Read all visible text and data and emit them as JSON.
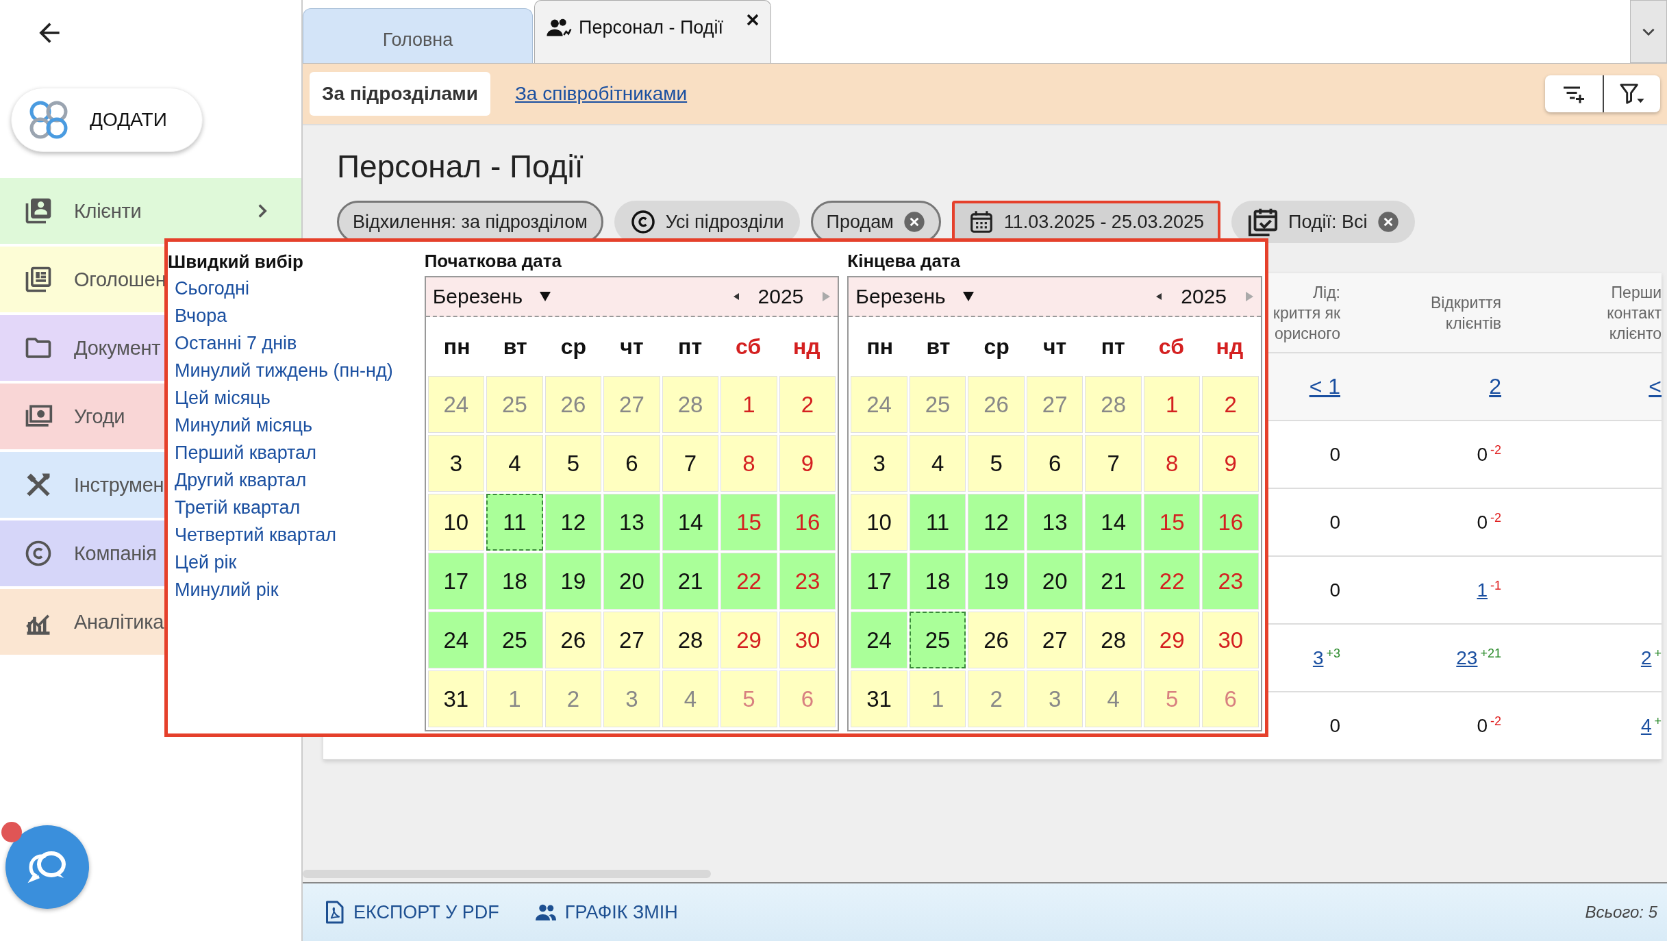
{
  "add_button": "ДОДАТИ",
  "sidebar": {
    "items": [
      {
        "label": "Клієнти",
        "kind": "contacts",
        "color": "#dff9d9",
        "has_submenu": true
      },
      {
        "label": "Оголошен",
        "kind": "news",
        "color": "#fdfdd6"
      },
      {
        "label": "Документ",
        "kind": "folder",
        "color": "#e3d7f9"
      },
      {
        "label": "Угоди",
        "kind": "money",
        "color": "#f9d6d6"
      },
      {
        "label": "Інструмен",
        "kind": "tools",
        "color": "#d8e8fb"
      },
      {
        "label": "Компанія",
        "kind": "company",
        "color": "#d6d6f9"
      },
      {
        "label": "Аналітика",
        "kind": "analytics",
        "color": "#fbe6d2"
      }
    ]
  },
  "tabs": [
    {
      "label": "Головна",
      "selected": false,
      "closable": false
    },
    {
      "label": "Персонал - Події",
      "selected": true,
      "closable": true
    }
  ],
  "subtabs": [
    {
      "label": "За підрозділами",
      "selected": true
    },
    {
      "label": "За співробітниками",
      "selected": false
    }
  ],
  "page_title": "Персонал - Події",
  "chips": [
    {
      "label": "Відхилення: за підрозділом",
      "kind": "deviation",
      "outlined": true,
      "closable": false,
      "active": false
    },
    {
      "label": "Усі підрозділи",
      "kind": "department",
      "outlined": false,
      "closable": false,
      "active": false
    },
    {
      "label": "Продам",
      "kind": "category",
      "outlined": true,
      "closable": true,
      "active": false
    },
    {
      "label": "11.03.2025 - 25.03.2025",
      "kind": "period",
      "outlined": true,
      "closable": false,
      "active": true
    },
    {
      "label": "Події: Всі",
      "kind": "events",
      "outlined": false,
      "closable": true,
      "active": false
    }
  ],
  "table": {
    "columns": [
      {
        "lines": [
          "Лід:",
          "криття як",
          "орисного"
        ]
      },
      {
        "lines": [
          "Відкриття",
          "клієнтів"
        ]
      },
      {
        "lines": [
          "Перши",
          "контакт",
          "клієнто"
        ]
      }
    ],
    "total": [
      {
        "value": "< 1",
        "link": true
      },
      {
        "value": "2",
        "link": true
      },
      {
        "value": "<",
        "link": true
      }
    ],
    "rows": [
      {
        "cells": [
          {
            "value": "0",
            "link": false
          },
          {
            "value": "0",
            "link": false,
            "delta": "-2",
            "color": "#e02020"
          }
        ]
      },
      {
        "cells": [
          {
            "value": "0",
            "link": false
          },
          {
            "value": "0",
            "link": false,
            "delta": "-2",
            "color": "#e02020"
          }
        ]
      },
      {
        "cells": [
          {
            "value": "0",
            "link": false
          },
          {
            "value": "1",
            "link": true,
            "delta": "-1",
            "color": "#e02020"
          }
        ]
      },
      {
        "cells": [
          {
            "value": "3",
            "link": true,
            "delta": "+3",
            "color": "#2a8a2a"
          },
          {
            "value": "23",
            "link": true,
            "delta": "+21",
            "color": "#2a8a2a"
          },
          {
            "value": "2",
            "link": true,
            "delta": "+",
            "color": "#2a8a2a"
          }
        ]
      },
      {
        "cells": [
          {
            "value": "0",
            "link": false
          },
          {
            "value": "0",
            "link": false,
            "delta": "-2",
            "color": "#e02020"
          },
          {
            "value": "4",
            "link": true,
            "delta": "+",
            "color": "#2a8a2a"
          }
        ]
      }
    ]
  },
  "popup": {
    "quick_title": "Швидкий вибір",
    "quick_items": [
      "Сьогодні",
      "Вчора",
      "Останні 7 днів",
      "Минулий тиждень (пн-нд)",
      "Цей місяць",
      "Минулий місяць",
      "Перший квартал",
      "Другий квартал",
      "Третій квартал",
      "Четвертий квартал",
      "Цей рік",
      "Минулий рік"
    ],
    "calendars": [
      {
        "label": "Початкова дата",
        "month": "Березень",
        "year": "2025",
        "weekdays": [
          "пн",
          "вт",
          "ср",
          "чт",
          "пт",
          "сб",
          "нд"
        ],
        "weeks": [
          [
            {
              "d": "24",
              "outside": true,
              "in_range": false,
              "selected": false
            },
            {
              "d": "25",
              "outside": true,
              "in_range": false,
              "selected": false
            },
            {
              "d": "26",
              "outside": true,
              "in_range": false,
              "selected": false
            },
            {
              "d": "27",
              "outside": true,
              "in_range": false,
              "selected": false
            },
            {
              "d": "28",
              "outside": true,
              "in_range": false,
              "selected": false
            },
            {
              "d": "1",
              "outside": false,
              "in_range": false,
              "selected": false
            },
            {
              "d": "2",
              "outside": false,
              "in_range": false,
              "selected": false
            }
          ],
          [
            {
              "d": "3",
              "outside": false,
              "in_range": false,
              "selected": false
            },
            {
              "d": "4",
              "outside": false,
              "in_range": false,
              "selected": false
            },
            {
              "d": "5",
              "outside": false,
              "in_range": false,
              "selected": false
            },
            {
              "d": "6",
              "outside": false,
              "in_range": false,
              "selected": false
            },
            {
              "d": "7",
              "outside": false,
              "in_range": false,
              "selected": false
            },
            {
              "d": "8",
              "outside": false,
              "in_range": false,
              "selected": false
            },
            {
              "d": "9",
              "outside": false,
              "in_range": false,
              "selected": false
            }
          ],
          [
            {
              "d": "10",
              "outside": false,
              "in_range": false,
              "selected": false
            },
            {
              "d": "11",
              "outside": false,
              "in_range": true,
              "selected": true
            },
            {
              "d": "12",
              "outside": false,
              "in_range": true,
              "selected": false
            },
            {
              "d": "13",
              "outside": false,
              "in_range": true,
              "selected": false
            },
            {
              "d": "14",
              "outside": false,
              "in_range": true,
              "selected": false
            },
            {
              "d": "15",
              "outside": false,
              "in_range": true,
              "selected": false
            },
            {
              "d": "16",
              "outside": false,
              "in_range": true,
              "selected": false
            }
          ],
          [
            {
              "d": "17",
              "outside": false,
              "in_range": true,
              "selected": false
            },
            {
              "d": "18",
              "outside": false,
              "in_range": true,
              "selected": false
            },
            {
              "d": "19",
              "outside": false,
              "in_range": true,
              "selected": false
            },
            {
              "d": "20",
              "outside": false,
              "in_range": true,
              "selected": false
            },
            {
              "d": "21",
              "outside": false,
              "in_range": true,
              "selected": false
            },
            {
              "d": "22",
              "outside": false,
              "in_range": true,
              "selected": false
            },
            {
              "d": "23",
              "outside": false,
              "in_range": true,
              "selected": false
            }
          ],
          [
            {
              "d": "24",
              "outside": false,
              "in_range": true,
              "selected": false
            },
            {
              "d": "25",
              "outside": false,
              "in_range": true,
              "selected": false
            },
            {
              "d": "26",
              "outside": false,
              "in_range": false,
              "selected": false
            },
            {
              "d": "27",
              "outside": false,
              "in_range": false,
              "selected": false
            },
            {
              "d": "28",
              "outside": false,
              "in_range": false,
              "selected": false
            },
            {
              "d": "29",
              "outside": false,
              "in_range": false,
              "selected": false
            },
            {
              "d": "30",
              "outside": false,
              "in_range": false,
              "selected": false
            }
          ],
          [
            {
              "d": "31",
              "outside": false,
              "in_range": false,
              "selected": false
            },
            {
              "d": "1",
              "outside": true,
              "in_range": false,
              "selected": false
            },
            {
              "d": "2",
              "outside": true,
              "in_range": false,
              "selected": false
            },
            {
              "d": "3",
              "outside": true,
              "in_range": false,
              "selected": false
            },
            {
              "d": "4",
              "outside": true,
              "in_range": false,
              "selected": false
            },
            {
              "d": "5",
              "outside": true,
              "in_range": false,
              "selected": false
            },
            {
              "d": "6",
              "outside": true,
              "in_range": false,
              "selected": false
            }
          ]
        ]
      },
      {
        "label": "Кінцева дата",
        "month": "Березень",
        "year": "2025",
        "weekdays": [
          "пн",
          "вт",
          "ср",
          "чт",
          "пт",
          "сб",
          "нд"
        ],
        "weeks": [
          [
            {
              "d": "24",
              "outside": true,
              "in_range": false,
              "selected": false
            },
            {
              "d": "25",
              "outside": true,
              "in_range": false,
              "selected": false
            },
            {
              "d": "26",
              "outside": true,
              "in_range": false,
              "selected": false
            },
            {
              "d": "27",
              "outside": true,
              "in_range": false,
              "selected": false
            },
            {
              "d": "28",
              "outside": true,
              "in_range": false,
              "selected": false
            },
            {
              "d": "1",
              "outside": false,
              "in_range": false,
              "selected": false
            },
            {
              "d": "2",
              "outside": false,
              "in_range": false,
              "selected": false
            }
          ],
          [
            {
              "d": "3",
              "outside": false,
              "in_range": false,
              "selected": false
            },
            {
              "d": "4",
              "outside": false,
              "in_range": false,
              "selected": false
            },
            {
              "d": "5",
              "outside": false,
              "in_range": false,
              "selected": false
            },
            {
              "d": "6",
              "outside": false,
              "in_range": false,
              "selected": false
            },
            {
              "d": "7",
              "outside": false,
              "in_range": false,
              "selected": false
            },
            {
              "d": "8",
              "outside": false,
              "in_range": false,
              "selected": false
            },
            {
              "d": "9",
              "outside": false,
              "in_range": false,
              "selected": false
            }
          ],
          [
            {
              "d": "10",
              "outside": false,
              "in_range": false,
              "selected": false
            },
            {
              "d": "11",
              "outside": false,
              "in_range": true,
              "selected": false
            },
            {
              "d": "12",
              "outside": false,
              "in_range": true,
              "selected": false
            },
            {
              "d": "13",
              "outside": false,
              "in_range": true,
              "selected": false
            },
            {
              "d": "14",
              "outside": false,
              "in_range": true,
              "selected": false
            },
            {
              "d": "15",
              "outside": false,
              "in_range": true,
              "selected": false
            },
            {
              "d": "16",
              "outside": false,
              "in_range": true,
              "selected": false
            }
          ],
          [
            {
              "d": "17",
              "outside": false,
              "in_range": true,
              "selected": false
            },
            {
              "d": "18",
              "outside": false,
              "in_range": true,
              "selected": false
            },
            {
              "d": "19",
              "outside": false,
              "in_range": true,
              "selected": false
            },
            {
              "d": "20",
              "outside": false,
              "in_range": true,
              "selected": false
            },
            {
              "d": "21",
              "outside": false,
              "in_range": true,
              "selected": false
            },
            {
              "d": "22",
              "outside": false,
              "in_range": true,
              "selected": false
            },
            {
              "d": "23",
              "outside": false,
              "in_range": true,
              "selected": false
            }
          ],
          [
            {
              "d": "24",
              "outside": false,
              "in_range": true,
              "selected": false
            },
            {
              "d": "25",
              "outside": false,
              "in_range": true,
              "selected": true
            },
            {
              "d": "26",
              "outside": false,
              "in_range": false,
              "selected": false
            },
            {
              "d": "27",
              "outside": false,
              "in_range": false,
              "selected": false
            },
            {
              "d": "28",
              "outside": false,
              "in_range": false,
              "selected": false
            },
            {
              "d": "29",
              "outside": false,
              "in_range": false,
              "selected": false
            },
            {
              "d": "30",
              "outside": false,
              "in_range": false,
              "selected": false
            }
          ],
          [
            {
              "d": "31",
              "outside": false,
              "in_range": false,
              "selected": false
            },
            {
              "d": "1",
              "outside": true,
              "in_range": false,
              "selected": false
            },
            {
              "d": "2",
              "outside": true,
              "in_range": false,
              "selected": false
            },
            {
              "d": "3",
              "outside": true,
              "in_range": false,
              "selected": false
            },
            {
              "d": "4",
              "outside": true,
              "in_range": false,
              "selected": false
            },
            {
              "d": "5",
              "outside": true,
              "in_range": false,
              "selected": false
            },
            {
              "d": "6",
              "outside": true,
              "in_range": false,
              "selected": false
            }
          ]
        ]
      }
    ]
  },
  "footer": {
    "actions": [
      {
        "label": "ЕКСПОРТ У PDF",
        "kind": "export"
      },
      {
        "label": "ГРАФІК ЗМІН",
        "kind": "schedule"
      }
    ],
    "total": "Всього: 5"
  }
}
